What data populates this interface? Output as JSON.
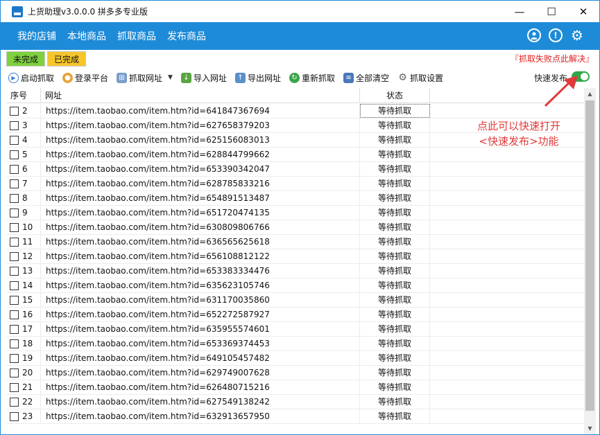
{
  "window": {
    "title": "上货助理v3.0.0.0 拼多多专业版",
    "controls": [
      "—",
      "☐",
      "✕"
    ]
  },
  "nav": {
    "items": [
      "我的店铺",
      "本地商品",
      "抓取商品",
      "发布商品"
    ],
    "icons": [
      "user-icon",
      "info-icon",
      "gear-icon"
    ]
  },
  "tabs": {
    "undone": "未完成",
    "done": "已完成",
    "fail_link": "『抓取失败点此解决』"
  },
  "toolbar": {
    "start": "启动抓取",
    "login": "登录平台",
    "grab_url": "抓取网址",
    "import_url": "导入网址",
    "export_url": "导出网址",
    "regrab": "重新抓取",
    "clear_all": "全部清空",
    "grab_settings": "抓取设置",
    "fast_publish": "快速发布",
    "fast_publish_on": true
  },
  "table": {
    "headers": {
      "no": "序号",
      "url": "网址",
      "status": "状态"
    },
    "rows": [
      {
        "no": "2",
        "url": "https://item.taobao.com/item.htm?id=641847367694",
        "status": "等待抓取"
      },
      {
        "no": "3",
        "url": "https://item.taobao.com/item.htm?id=627658379203",
        "status": "等待抓取"
      },
      {
        "no": "4",
        "url": "https://item.taobao.com/item.htm?id=625156083013",
        "status": "等待抓取"
      },
      {
        "no": "5",
        "url": "https://item.taobao.com/item.htm?id=628844799662",
        "status": "等待抓取"
      },
      {
        "no": "6",
        "url": "https://item.taobao.com/item.htm?id=653390342047",
        "status": "等待抓取"
      },
      {
        "no": "7",
        "url": "https://item.taobao.com/item.htm?id=628785833216",
        "status": "等待抓取"
      },
      {
        "no": "8",
        "url": "https://item.taobao.com/item.htm?id=654891513487",
        "status": "等待抓取"
      },
      {
        "no": "9",
        "url": "https://item.taobao.com/item.htm?id=651720474135",
        "status": "等待抓取"
      },
      {
        "no": "10",
        "url": "https://item.taobao.com/item.htm?id=630809806766",
        "status": "等待抓取"
      },
      {
        "no": "11",
        "url": "https://item.taobao.com/item.htm?id=636565625618",
        "status": "等待抓取"
      },
      {
        "no": "12",
        "url": "https://item.taobao.com/item.htm?id=656108812122",
        "status": "等待抓取"
      },
      {
        "no": "13",
        "url": "https://item.taobao.com/item.htm?id=653383334476",
        "status": "等待抓取"
      },
      {
        "no": "14",
        "url": "https://item.taobao.com/item.htm?id=635623105746",
        "status": "等待抓取"
      },
      {
        "no": "15",
        "url": "https://item.taobao.com/item.htm?id=631170035860",
        "status": "等待抓取"
      },
      {
        "no": "16",
        "url": "https://item.taobao.com/item.htm?id=652272587927",
        "status": "等待抓取"
      },
      {
        "no": "17",
        "url": "https://item.taobao.com/item.htm?id=635955574601",
        "status": "等待抓取"
      },
      {
        "no": "18",
        "url": "https://item.taobao.com/item.htm?id=653369374453",
        "status": "等待抓取"
      },
      {
        "no": "19",
        "url": "https://item.taobao.com/item.htm?id=649105457482",
        "status": "等待抓取"
      },
      {
        "no": "20",
        "url": "https://item.taobao.com/item.htm?id=629749007628",
        "status": "等待抓取"
      },
      {
        "no": "21",
        "url": "https://item.taobao.com/item.htm?id=626480715216",
        "status": "等待抓取"
      },
      {
        "no": "22",
        "url": "https://item.taobao.com/item.htm?id=627549138242",
        "status": "等待抓取"
      },
      {
        "no": "23",
        "url": "https://item.taobao.com/item.htm?id=632913657950",
        "status": "等待抓取"
      }
    ]
  },
  "annotation": {
    "line1": "点此可以快速打开",
    "line2": "<快速发布>功能"
  },
  "colors": {
    "primary": "#1e8bd8",
    "undone_tab": "#7ed03e",
    "done_tab": "#f5c52b",
    "alert_red": "#e02020",
    "toggle_on": "#2fa84a",
    "annotation": "#e03a3a"
  }
}
